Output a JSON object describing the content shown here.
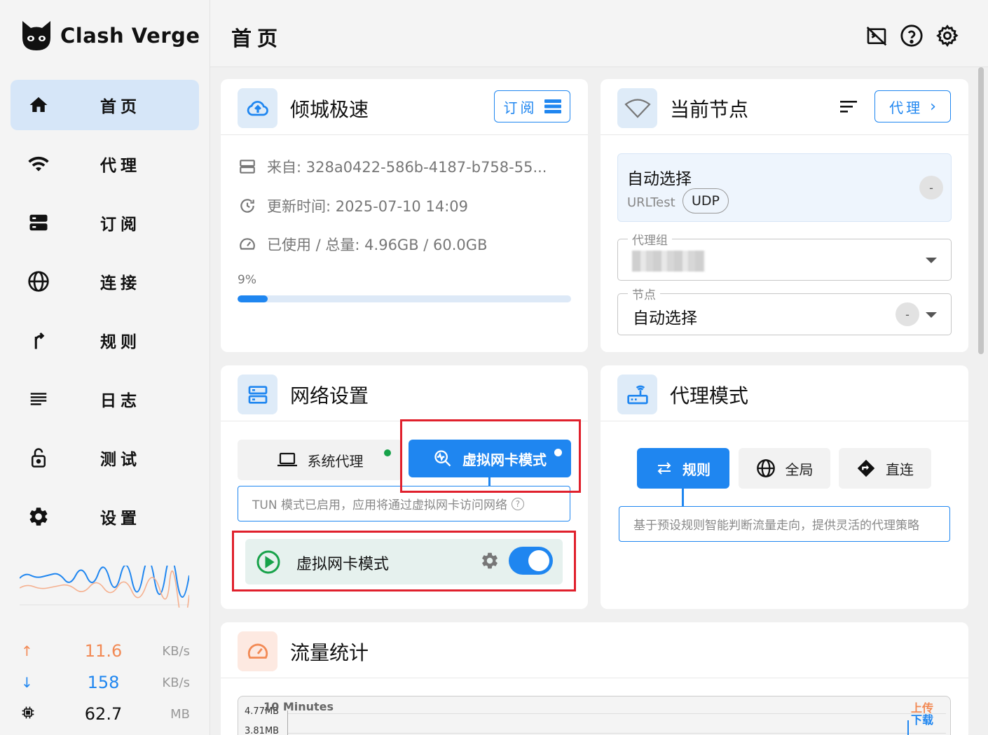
{
  "app": {
    "name": "Clash Verge"
  },
  "sidebar": {
    "items": [
      {
        "label": "首页",
        "icon": "home-icon",
        "active": true
      },
      {
        "label": "代理",
        "icon": "wifi-icon",
        "active": false
      },
      {
        "label": "订阅",
        "icon": "storage-icon",
        "active": false
      },
      {
        "label": "连接",
        "icon": "globe-icon",
        "active": false
      },
      {
        "label": "规则",
        "icon": "fork-icon",
        "active": false
      },
      {
        "label": "日志",
        "icon": "list-icon",
        "active": false
      },
      {
        "label": "测试",
        "icon": "lock-icon",
        "active": false
      },
      {
        "label": "设置",
        "icon": "gear-icon",
        "active": false
      }
    ],
    "speed": {
      "up": {
        "value": "11.6",
        "unit": "KB/s",
        "color": "#f28a55"
      },
      "down": {
        "value": "158",
        "unit": "KB/s",
        "color": "#1f86f0"
      },
      "memory": {
        "value": "62.7",
        "unit": "MB"
      }
    }
  },
  "header": {
    "title": "首页"
  },
  "profile_card": {
    "title": "倾城极速",
    "subscribe_button": "订阅",
    "from": "来自: 328a0422-586b-4187-b758-55...",
    "updated": "更新时间: 2025-07-10 14:09",
    "usage": "已使用 / 总量: 4.96GB / 60.0GB",
    "progress_label": "9%",
    "progress_percent": 9
  },
  "node_card": {
    "title": "当前节点",
    "proxy_button": "代理",
    "node_name": "自动选择",
    "node_type": "URLTest",
    "node_chip": "UDP",
    "delay": "-",
    "group_label": "代理组",
    "node_label": "节点",
    "node_value": "自动选择",
    "node_delay": "-"
  },
  "network_card": {
    "title": "网络设置",
    "system_proxy": "系统代理",
    "tun_mode": "虚拟网卡模式",
    "hint": "TUN 模式已启用，应用将通过虚拟网卡访问网络",
    "tun_row_label": "虚拟网卡模式",
    "tun_enabled": true
  },
  "mode_card": {
    "title": "代理模式",
    "rule": "规则",
    "global": "全局",
    "direct": "直连",
    "hint": "基于预设规则智能判断流量走向，提供灵活的代理策略"
  },
  "traffic_card": {
    "title": "流量统计",
    "time_range": "10 Minutes",
    "y_ticks": [
      "4.77MB",
      "3.81MB"
    ],
    "legend_up": "上传",
    "legend_down": "下载",
    "up_color": "#f28a55",
    "down_color": "#1f86f0"
  }
}
